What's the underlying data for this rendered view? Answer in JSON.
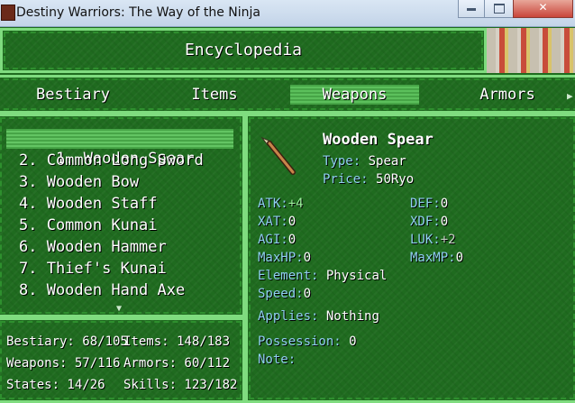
{
  "window": {
    "title": "Destiny Warriors: The Way of the Ninja",
    "close_glyph": "✕"
  },
  "header": {
    "title": "Encyclopedia"
  },
  "tabs": [
    {
      "label": "Bestiary"
    },
    {
      "label": "Items"
    },
    {
      "label": "Weapons",
      "active": true
    },
    {
      "label": "Armors"
    }
  ],
  "list": {
    "items": [
      {
        "label": "1. Wooden Spear",
        "icon": "spear-icon"
      },
      {
        "label": "2. Common Long Sword",
        "icon": "sword-icon"
      },
      {
        "label": "3. Wooden Bow",
        "icon": "bow-icon"
      },
      {
        "label": "4. Wooden Staff",
        "icon": "staff-icon"
      },
      {
        "label": "5. Common Kunai",
        "icon": "kunai-icon"
      },
      {
        "label": "6. Wooden Hammer",
        "icon": "hammer-icon"
      },
      {
        "label": "7. Thief's Kunai",
        "icon": "kunai-icon"
      },
      {
        "label": "8. Wooden Hand Axe",
        "icon": "axe-icon"
      }
    ],
    "selected": 0
  },
  "stats": {
    "bestiary": "Bestiary: 68/105",
    "items": "Items: 148/183",
    "weapons": "Weapons: 57/116",
    "armors": "Armors: 60/112",
    "states": "States: 14/26",
    "skills": "Skills: 123/182"
  },
  "detail": {
    "name": "Wooden Spear",
    "type_label": "Type:",
    "type_value": "Spear",
    "price_label": "Price:",
    "price_value": "50Ryo",
    "atk_label": "ATK:",
    "atk_value": "+4",
    "def_label": "DEF:",
    "def_value": "0",
    "xat_label": "XAT:",
    "xat_value": "0",
    "xdf_label": "XDF:",
    "xdf_value": "0",
    "agi_label": "AGI:",
    "agi_value": "0",
    "luk_label": "LUK:",
    "luk_value": "+2",
    "maxhp_label": "MaxHP:",
    "maxhp_value": "0",
    "maxmp_label": "MaxMP:",
    "maxmp_value": "0",
    "element_label": "Element:",
    "element_value": "Physical",
    "speed_label": "Speed:",
    "speed_value": "0",
    "applies_label": "Applies:",
    "applies_value": "Nothing",
    "possession_label": "Possession:",
    "possession_value": "0",
    "note_label": "Note:"
  }
}
